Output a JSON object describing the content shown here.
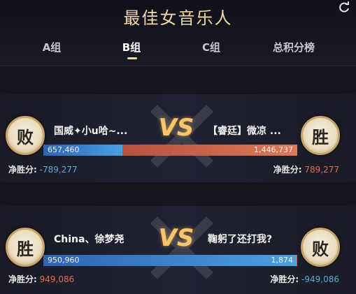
{
  "header": {
    "title": "最佳女音乐人",
    "refresh_icon": "refresh-icon"
  },
  "tabs": [
    {
      "label": "A组",
      "active": false
    },
    {
      "label": "B组",
      "active": true
    },
    {
      "label": "C组",
      "active": false
    },
    {
      "label": "总积分榜",
      "active": false
    }
  ],
  "matches": [
    {
      "vs_label": "VS",
      "left": {
        "badge": "败",
        "name": "国威✦小u哈~...",
        "score": "657,460",
        "net_label": "净胜分:",
        "net_value": "-789,277"
      },
      "right": {
        "badge": "胜",
        "name": "【睿廷】微凉 ...",
        "score": "1,446,737",
        "net_label": "净胜分:",
        "net_value": "789,277"
      },
      "left_share": 0.3125
    },
    {
      "vs_label": "VS",
      "left": {
        "badge": "胜",
        "name": "China、徐梦尧",
        "score": "950,960",
        "net_label": "净胜分:",
        "net_value": "949,086"
      },
      "right": {
        "badge": "败",
        "name": "鞠躬了还打我?",
        "score": "1,874",
        "net_label": "净胜分:",
        "net_value": "-949,086"
      },
      "left_share": 0.998
    }
  ],
  "colors": {
    "accent_gold": "#f2d7a6",
    "vs_gold": "#f7c56b",
    "blue_bar": "#4aa1e0",
    "red_bar": "#d97a5a",
    "neg_text": "#5aa9d6",
    "pos_text": "#e06b54"
  }
}
